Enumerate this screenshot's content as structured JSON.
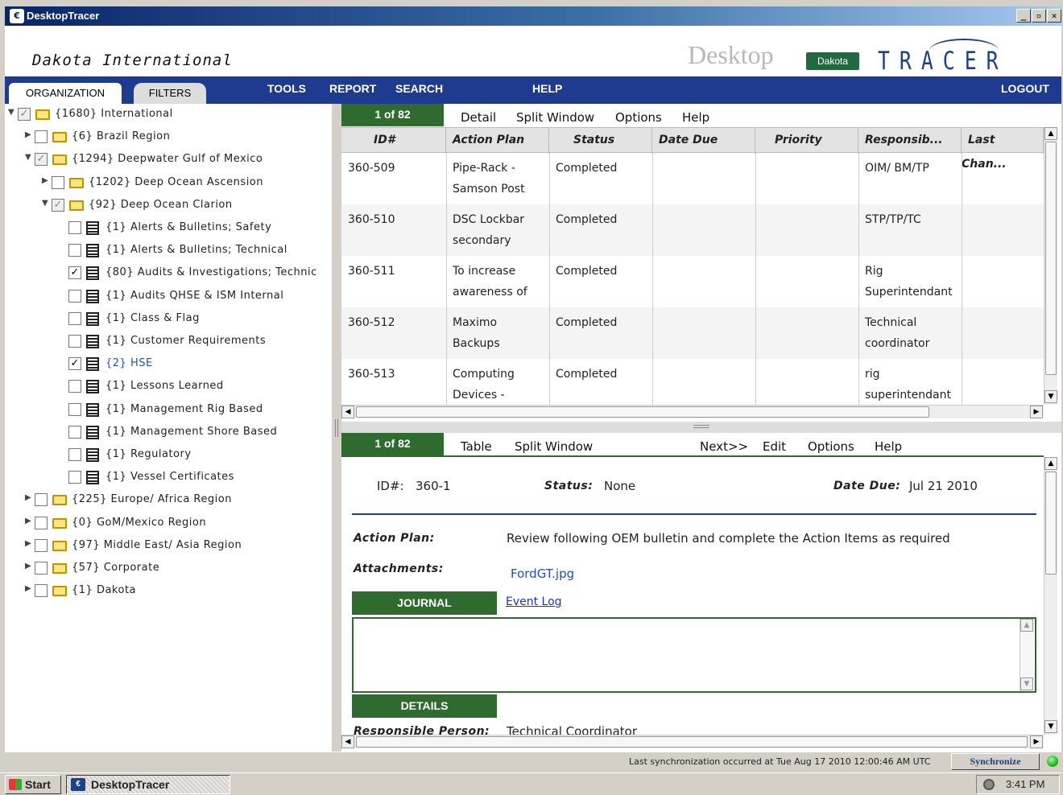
{
  "window": {
    "title": "DesktopTracer",
    "controls": [
      "_",
      "▫",
      "✕"
    ]
  },
  "header": {
    "company": "Dakota International",
    "brand_desktop": "Desktop",
    "brand_dakota": "Dakota",
    "brand_tracer": "TRACER"
  },
  "tabs": {
    "organization": "ORGANIZATION",
    "filters": "FILTERS"
  },
  "menu": {
    "tools": "TOOLS",
    "report": "REPORT",
    "search": "SEARCH",
    "help": "HELP",
    "logout": "LOGOUT"
  },
  "tree": [
    {
      "label": "{1680} International",
      "expanded": true,
      "checked": "partial",
      "icon": "folder-icon",
      "link": false
    },
    {
      "label": "{6} Brazil Region",
      "expanded": false,
      "checked": "none",
      "icon": "folder-icon",
      "link": false
    },
    {
      "label": "{1294} Deepwater Gulf of Mexico",
      "expanded": true,
      "checked": "partial",
      "icon": "folder-icon",
      "link": false
    },
    {
      "label": "{1202} Deep Ocean Ascension",
      "expanded": false,
      "checked": "none",
      "icon": "folder-icon",
      "link": false
    },
    {
      "label": "{92} Deep Ocean Clarion",
      "expanded": true,
      "checked": "partial",
      "icon": "folder-icon",
      "link": false
    },
    {
      "label": "{1} Alerts & Bulletins; Safety",
      "checked": "none",
      "icon": "document-icon",
      "link": false
    },
    {
      "label": "{1} Alerts & Bulletins; Technical",
      "checked": "none",
      "icon": "document-icon",
      "link": false
    },
    {
      "label": "{80} Audits & Investigations; Technic",
      "checked": "checked",
      "icon": "document-icon",
      "link": false
    },
    {
      "label": "{1} Audits QHSE & ISM Internal",
      "checked": "none",
      "icon": "document-icon",
      "link": false
    },
    {
      "label": "{1} Class & Flag",
      "checked": "none",
      "icon": "document-icon",
      "link": false
    },
    {
      "label": "{1} Customer Requirements",
      "checked": "none",
      "icon": "document-icon",
      "link": false
    },
    {
      "label": "{2} HSE",
      "checked": "checked",
      "icon": "document-icon",
      "link": true
    },
    {
      "label": "{1} Lessons Learned",
      "checked": "none",
      "icon": "document-icon",
      "link": false
    },
    {
      "label": "{1} Management Rig Based",
      "checked": "none",
      "icon": "document-icon",
      "link": false
    },
    {
      "label": "{1} Management Shore Based",
      "checked": "none",
      "icon": "document-icon",
      "link": false
    },
    {
      "label": "{1} Regulatory",
      "checked": "none",
      "icon": "document-icon",
      "link": false
    },
    {
      "label": "{1} Vessel Certificates",
      "checked": "none",
      "icon": "document-icon",
      "link": false
    },
    {
      "label": "{225} Europe/ Africa Region",
      "expanded": false,
      "checked": "none",
      "icon": "folder-icon",
      "link": false
    },
    {
      "label": "{0} GoM/Mexico Region",
      "expanded": false,
      "checked": "none",
      "icon": "folder-icon",
      "link": false
    },
    {
      "label": "{97} Middle East/ Asia Region",
      "expanded": false,
      "checked": "none",
      "icon": "folder-icon",
      "link": false
    },
    {
      "label": "{57} Corporate",
      "expanded": false,
      "checked": "none",
      "icon": "folder-icon",
      "link": false
    },
    {
      "label": "{1} Dakota",
      "expanded": false,
      "checked": "none",
      "icon": "folder-icon",
      "link": false
    }
  ],
  "table_view": {
    "page_badge": "1 of 82",
    "toolbar": [
      "Detail",
      "Split Window",
      "Options",
      "Help"
    ],
    "columns": [
      "ID#",
      "Action Plan",
      "Status",
      "Date Due",
      "Priority",
      "Responsib...",
      "Last Chan..."
    ],
    "rows": [
      {
        "id": "360-509",
        "plan": [
          "Pipe-Rack -",
          "Samson Post"
        ],
        "status": "Completed",
        "due": "",
        "priority": "",
        "resp": [
          "OIM/ BM/TP"
        ],
        "last": ""
      },
      {
        "id": "360-510",
        "plan": [
          "DSC Lockbar",
          "secondary"
        ],
        "status": "Completed",
        "due": "",
        "priority": "",
        "resp": [
          "STP/TP/TC"
        ],
        "last": ""
      },
      {
        "id": "360-511",
        "plan": [
          "To increase",
          "awareness of"
        ],
        "status": "Completed",
        "due": "",
        "priority": "",
        "resp": [
          "Rig",
          "Superintendant"
        ],
        "last": ""
      },
      {
        "id": "360-512",
        "plan": [
          "Maximo Backups"
        ],
        "status": "Completed",
        "due": "",
        "priority": "",
        "resp": [
          "Technical",
          "coordinator"
        ],
        "last": ""
      },
      {
        "id": "360-513",
        "plan": [
          "Computing",
          "Devices -"
        ],
        "status": "Completed",
        "due": "",
        "priority": "",
        "resp": [
          "rig",
          "superintendant"
        ],
        "last": ""
      }
    ]
  },
  "detail_view": {
    "page_badge": "1 of 82",
    "toolbar": {
      "table": "Table",
      "split": "Split Window",
      "next": "Next>>",
      "edit": "Edit",
      "options": "Options",
      "help": "Help"
    },
    "id_label": "ID#:",
    "id_value": "360-1",
    "status_label": "Status:",
    "status_value": "None",
    "due_label": "Date Due:",
    "due_value": "Jul 21 2010",
    "action_plan_label": "Action Plan:",
    "action_plan_value": "Review following OEM bulletin and complete the Action Items as required",
    "attachments_label": "Attachments:",
    "attachment": "FordGT.jpg",
    "journal_label": "JOURNAL",
    "event_log": "Event Log",
    "details_label": "DETAILS",
    "responsible_label": "Responsible Person:",
    "responsible_value": "Technical Coordinator"
  },
  "status_bar": {
    "sync_text": "Last synchronization occurred at Tue Aug 17 2010 12:00:46 AM UTC",
    "sync_button": "Synchronize"
  },
  "taskbar": {
    "start": "Start",
    "task": "DesktopTracer",
    "clock": "3:41 PM"
  }
}
